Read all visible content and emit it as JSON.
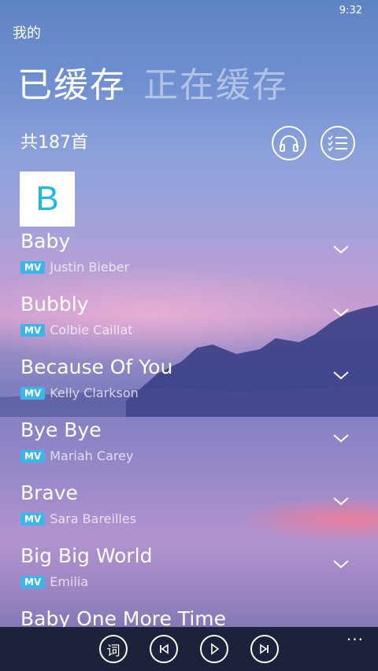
{
  "status": {
    "time": "9:32"
  },
  "header": {
    "title": "我的"
  },
  "pivot": {
    "active": "已缓存",
    "inactive": "正在缓存"
  },
  "summary": {
    "count": "共187首"
  },
  "group": {
    "letter": "B"
  },
  "songs": [
    {
      "title": "Baby",
      "badge": "MV",
      "artist": "Justin Bieber"
    },
    {
      "title": "Bubbly",
      "badge": "MV",
      "artist": "Colbie Caillat"
    },
    {
      "title": "Because Of You",
      "badge": "MV",
      "artist": "Kelly Clarkson"
    },
    {
      "title": "Bye Bye",
      "badge": "MV",
      "artist": "Mariah Carey"
    },
    {
      "title": "Brave",
      "badge": "MV",
      "artist": "Sara Bareilles"
    },
    {
      "title": "Big Big World",
      "badge": "MV",
      "artist": "Emilia"
    },
    {
      "title": "Baby One More Time",
      "badge": "",
      "artist": ""
    }
  ],
  "appbar": {
    "lyrics_label": "词",
    "more": "..."
  },
  "icons": [
    "headphones-icon",
    "multiselect-icon",
    "chevron-down-icon",
    "previous-icon",
    "play-icon",
    "next-icon"
  ]
}
